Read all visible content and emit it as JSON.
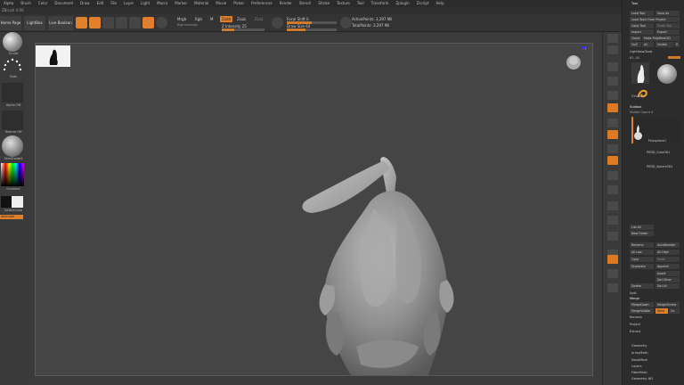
{
  "menu": [
    "Alpha",
    "Brush",
    "Color",
    "Document",
    "Draw",
    "Edit",
    "File",
    "Layer",
    "Light",
    "Macro",
    "Marker",
    "Material",
    "Movie",
    "Picker",
    "Preferences",
    "Render",
    "Stencil",
    "Stroke",
    "Texture",
    "Tool",
    "Transform",
    "Zplugin",
    "Zscript",
    "Help"
  ],
  "infobar": "ZBrush 4 R6",
  "toolbar": {
    "home_page": "Home Page",
    "lightbox": "LightBox",
    "live_boolean": "Live Boolean",
    "edit": "Edit",
    "draw": "Draw",
    "move": "Move",
    "scale": "Scale",
    "rotate": "Rotate",
    "mrgb": "Mrgb",
    "rgb": "Rgb",
    "m": "M",
    "zadd": "Zadd",
    "zsub": "Zsub",
    "zcut": "Zcut",
    "focal_shift": "Focal Shift 0",
    "draw_size": "Draw Size 64",
    "rgb_intensity": "Rgb Intensity",
    "z_intensity": "Z Intensity 25",
    "active_points": "ActivePoints: 3,297 Mil",
    "total_points": "TotalPoints: 3,297 Mil"
  },
  "left_tray": {
    "brush_label": "Sculpt",
    "stroke_label": "Dots",
    "alpha_label": "Alpha Off",
    "texture_label": "Texture Off",
    "material_label": "SkinShade4",
    "gradient_label": "Gradient",
    "switch_label": "SwitchColor",
    "alternate_label": "Alternate"
  },
  "right_panel": {
    "title": "Tool",
    "buttons": [
      [
        "Load Tool",
        "Save As"
      ],
      [
        "Load Tools From Project",
        ""
      ],
      [
        "Copy Tool",
        "Paste Tool"
      ],
      [
        "Import",
        "Export"
      ],
      [
        "Clone",
        "Make PolyMesh3D"
      ],
      [
        "GoZ",
        "All",
        "Visible",
        "R"
      ]
    ],
    "lightbox_tools": "Lightbox▸Tools",
    "tool_size": "63. All",
    "tool_name": "Dinosaur",
    "subtool_header": "Subtool",
    "visible_count": "Visible Count 4",
    "subtool_items": [
      "Polysphere1",
      "PM3D_Cube3D1",
      "PM3D_Sphere3D1"
    ],
    "list_all": "List All",
    "new_folder": "New Folder",
    "mid_buttons": [
      [
        "Rename",
        "AutoReorder"
      ],
      [
        "All Low",
        "All High"
      ],
      [
        "Copy",
        "Paste"
      ],
      [
        "Duplicate",
        "Append"
      ],
      [
        "",
        "Insert"
      ],
      [
        "",
        "Del Other"
      ],
      [
        "Delete",
        "Del All"
      ]
    ],
    "split": "Split",
    "merge": "Merge",
    "merge_rows": [
      [
        "MergeDown",
        "MergeSimilar"
      ],
      [
        "MergeVisible",
        "Weld",
        "Uv"
      ]
    ],
    "remesh": "Remesh",
    "project": "Project",
    "extract": "Extract",
    "sections": [
      "Geometry",
      "ArrayMesh",
      "NanoMesh",
      "Layers",
      "FiberMesh",
      "Geometry HD"
    ]
  }
}
